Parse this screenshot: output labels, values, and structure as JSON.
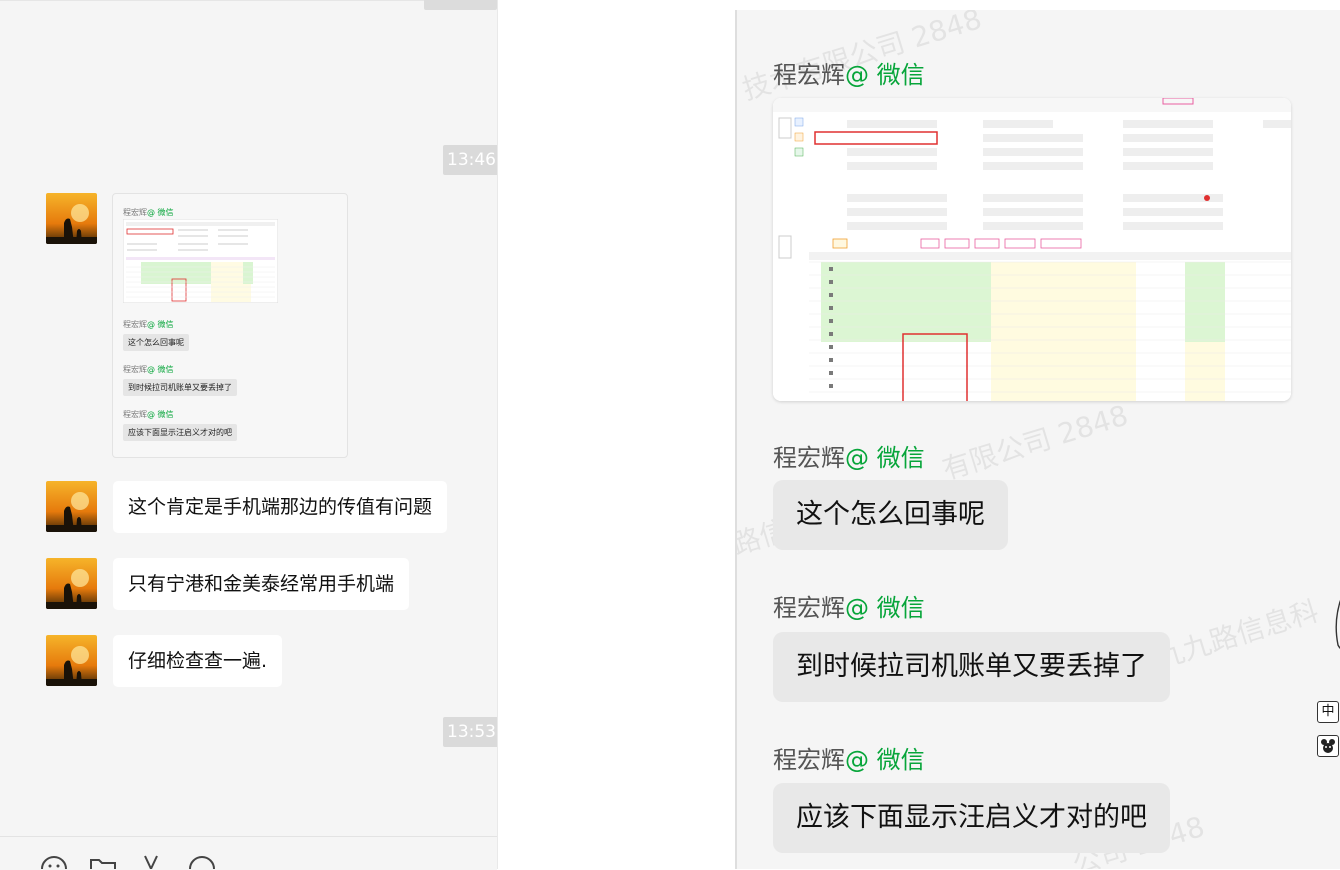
{
  "left_pane": {
    "timestamps": [
      "13:46",
      "13:53"
    ],
    "forwarded_card": {
      "items": [
        {
          "sender": "程宏辉",
          "tag": "@ 微信",
          "kind": "image"
        },
        {
          "sender": "程宏辉",
          "tag": "@ 微信",
          "text": "这个怎么回事呢"
        },
        {
          "sender": "程宏辉",
          "tag": "@ 微信",
          "text": "到时候拉司机账单又要丢掉了"
        },
        {
          "sender": "程宏辉",
          "tag": "@ 微信",
          "text": "应该下面显示汪启义才对的吧"
        }
      ]
    },
    "messages": [
      {
        "text": "这个肯定是手机端那边的传值有问题"
      },
      {
        "text": "只有宁港和金美泰经常用手机端"
      },
      {
        "text": "仔细检查查一遍."
      }
    ],
    "toolbar": [
      "emoji-icon",
      "folder-icon",
      "scissors-icon",
      "chat-icon"
    ]
  },
  "right_pane": {
    "watermarks": [
      "技术有限公司 2848",
      "有限公司 2848",
      "路信息",
      "宁波九九路信息科",
      "公司 2848"
    ],
    "items": [
      {
        "sender": "程宏辉",
        "tag": "@ 微信",
        "kind": "image"
      },
      {
        "sender": "程宏辉",
        "tag": "@ 微信",
        "text": "这个怎么回事呢"
      },
      {
        "sender": "程宏辉",
        "tag": "@ 微信",
        "text": "到时候拉司机账单又要丢掉了"
      },
      {
        "sender": "程宏辉",
        "tag": "@ 微信",
        "text": "应该下面显示汪启义才对的吧"
      }
    ],
    "side_icons": [
      {
        "icon": "ime-icon",
        "label": "中"
      },
      {
        "icon": "mascot-icon",
        "label": ""
      }
    ]
  },
  "colors": {
    "accent_green": "#07a53a",
    "bubble_white": "#ffffff",
    "timestamp_bg": "#dadada"
  }
}
